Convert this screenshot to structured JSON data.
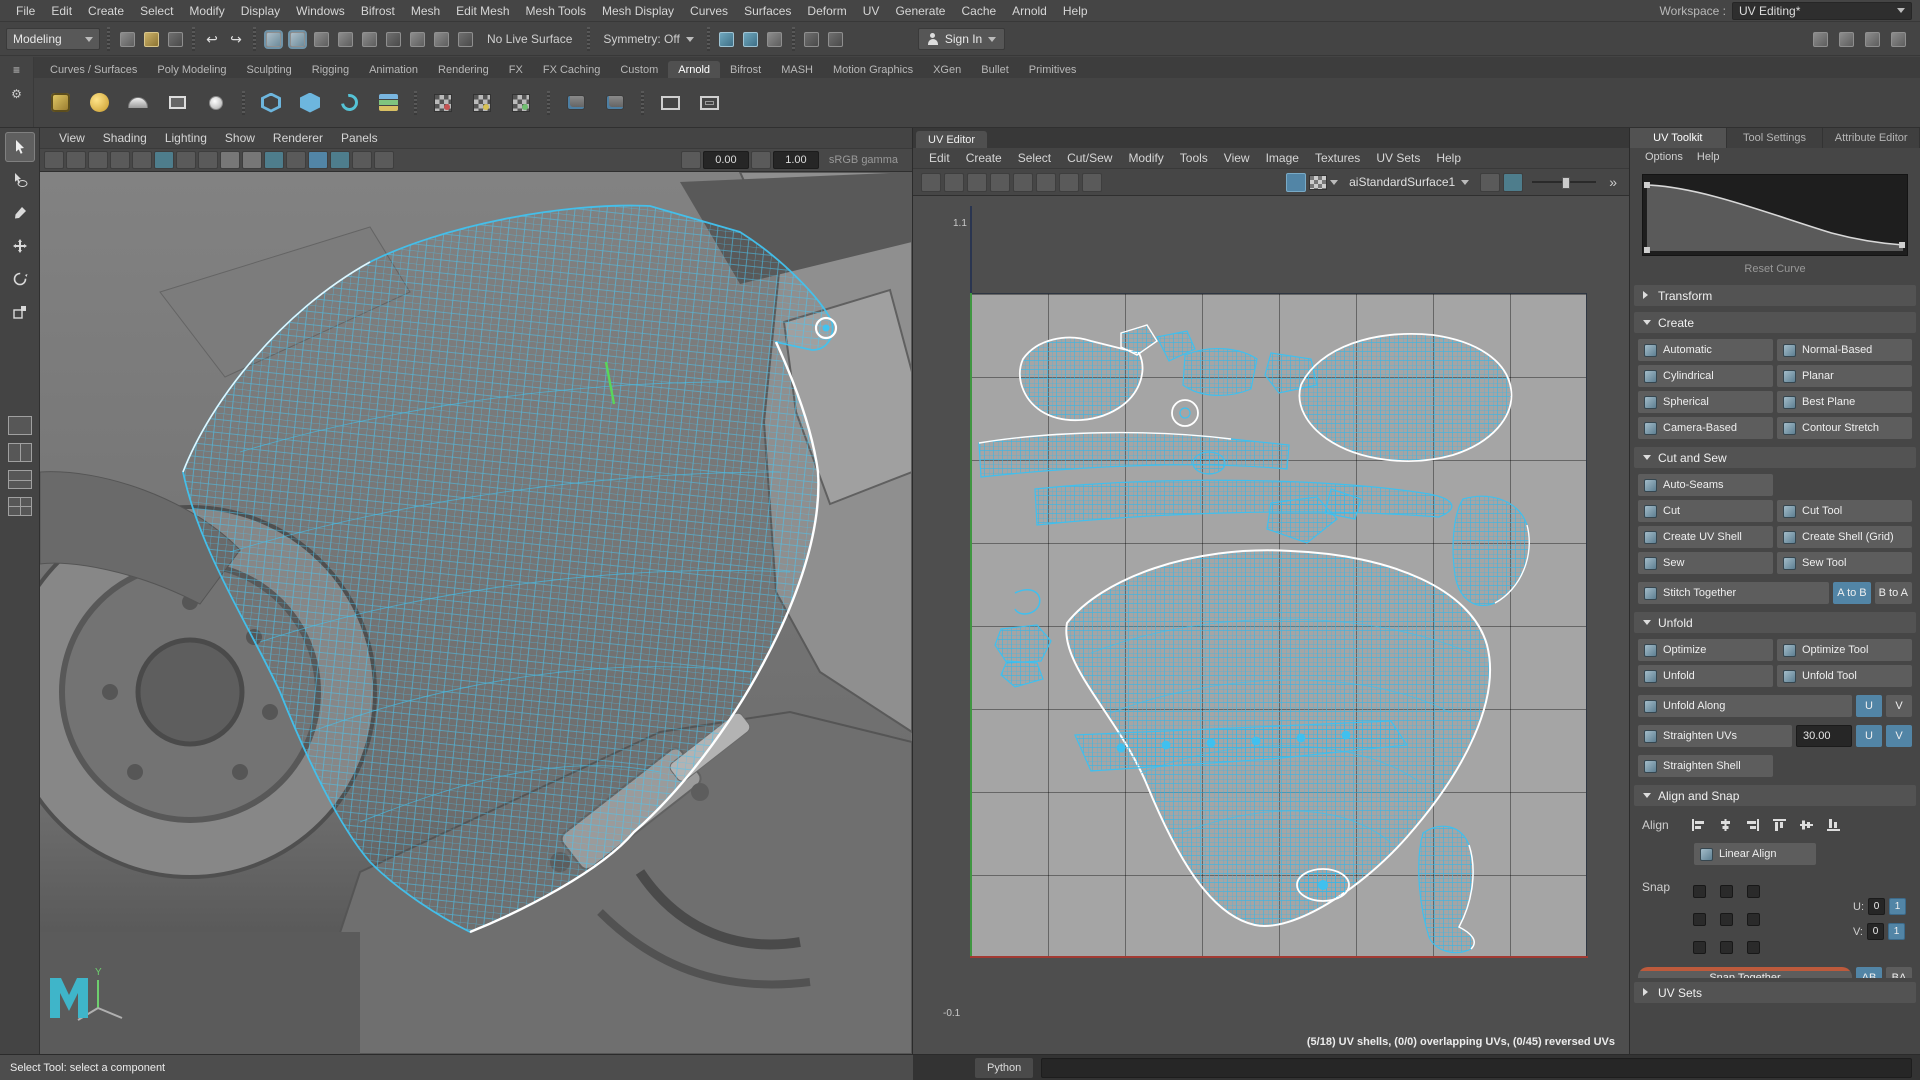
{
  "colors": {
    "accent": "#5285a6",
    "wireframe": "#3fc0ef",
    "selection_outline": "#ffffff",
    "axis_u": "#a23a33",
    "axis_v": "#3f9641"
  },
  "icons": {
    "undo": "↩",
    "redo": "↪",
    "menu": "≡",
    "gear": "⚙",
    "double_arrow": "»"
  },
  "menu_bar": {
    "items": [
      "File",
      "Edit",
      "Create",
      "Select",
      "Modify",
      "Display",
      "Windows",
      "Bifrost",
      "Mesh",
      "Edit Mesh",
      "Mesh Tools",
      "Mesh Display",
      "Curves",
      "Surfaces",
      "Deform",
      "UV",
      "Generate",
      "Cache",
      "Arnold",
      "Help"
    ],
    "workspace_label": "Workspace :",
    "workspace_value": "UV Editing*"
  },
  "status_line": {
    "mode": "Modeling",
    "no_live_surface": "No Live Surface",
    "symmetry": "Symmetry: Off",
    "sign_in": "Sign In"
  },
  "shelf": {
    "tabs": [
      "Curves / Surfaces",
      "Poly Modeling",
      "Sculpting",
      "Rigging",
      "Animation",
      "Rendering",
      "FX",
      "FX Caching",
      "Custom",
      "Arnold",
      "Bifrost",
      "MASH",
      "Motion Graphics",
      "XGen",
      "Bullet",
      "Primitives"
    ],
    "active_tab": "Arnold"
  },
  "viewport": {
    "menus": [
      "View",
      "Shading",
      "Lighting",
      "Show",
      "Renderer",
      "Panels"
    ],
    "exposure": "0.00",
    "gamma": "1.00",
    "view_transform": "sRGB gamma",
    "axis_y": "Y"
  },
  "uv_editor": {
    "tab_title": "UV Editor",
    "menus": [
      "Edit",
      "Create",
      "Select",
      "Cut/Sew",
      "Modify",
      "Tools",
      "View",
      "Image",
      "Textures",
      "UV Sets",
      "Help"
    ],
    "material": "aiStandardSurface1",
    "grid_label_top": "1.1",
    "grid_label_bottom": "-0.1",
    "status": "(5/18) UV shells, (0/0) overlapping UVs, (0/45) reversed UVs"
  },
  "toolkit": {
    "tabs": [
      "UV Toolkit",
      "Tool Settings",
      "Attribute Editor"
    ],
    "menus": [
      "Options",
      "Help"
    ],
    "reset_curve_label": "Reset Curve",
    "sections": {
      "transform": "Transform",
      "create": "Create",
      "cut_sew": "Cut and Sew",
      "unfold": "Unfold",
      "align_snap": "Align and Snap",
      "uv_sets": "UV Sets"
    },
    "create": {
      "buttons": [
        "Automatic",
        "Normal-Based",
        "Cylindrical",
        "Planar",
        "Spherical",
        "Best Plane",
        "Camera-Based",
        "Contour Stretch"
      ]
    },
    "cut_sew": {
      "auto_seams": "Auto-Seams",
      "cut": "Cut",
      "cut_tool": "Cut Tool",
      "create_uv_shell": "Create UV Shell",
      "create_shell_grid": "Create Shell (Grid)",
      "sew": "Sew",
      "sew_tool": "Sew Tool",
      "stitch_together": "Stitch Together",
      "a_to_b": "A to B",
      "b_to_a": "B to A"
    },
    "unfold": {
      "optimize": "Optimize",
      "optimize_tool": "Optimize Tool",
      "unfold": "Unfold",
      "unfold_tool": "Unfold Tool",
      "unfold_along": "Unfold Along",
      "u": "U",
      "v": "V",
      "straighten_uvs": "Straighten UVs",
      "straighten_angle": "30.00",
      "straighten_shell": "Straighten Shell"
    },
    "align_snap": {
      "align_label": "Align",
      "linear_align": "Linear Align",
      "snap_label": "Snap",
      "u_label": "U:",
      "v_label": "V:",
      "u_min": "0",
      "u_max": "1",
      "v_min": "0",
      "v_max": "1",
      "snap_together": "Snap Together",
      "ab": "AB",
      "ba": "BA"
    }
  },
  "bottom_bar": {
    "help_text": "Select Tool: select a component",
    "command_language": "Python"
  }
}
